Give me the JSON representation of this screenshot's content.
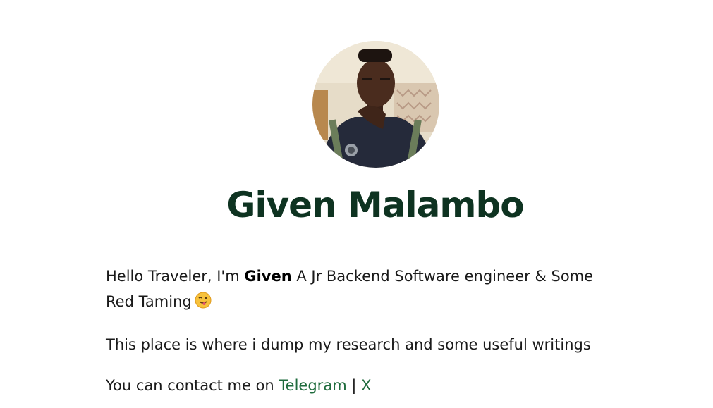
{
  "profile": {
    "name": "Given Malambo",
    "avatar_alt": "profile photo"
  },
  "intro": {
    "greeting": "Hello Traveler, I'm ",
    "name_bold": "Given",
    "role": " A Jr Backend Software engineer & Some Red Taming",
    "emoji": "wink-tongue-emoji"
  },
  "about": {
    "text": "This place is where i dump my research and some useful writings"
  },
  "contact": {
    "prefix": "You can contact me on ",
    "telegram_label": "Telegram",
    "separator": " | ",
    "x_label": "X"
  },
  "colors": {
    "title": "#0e3321",
    "link": "#1e6b3c"
  }
}
